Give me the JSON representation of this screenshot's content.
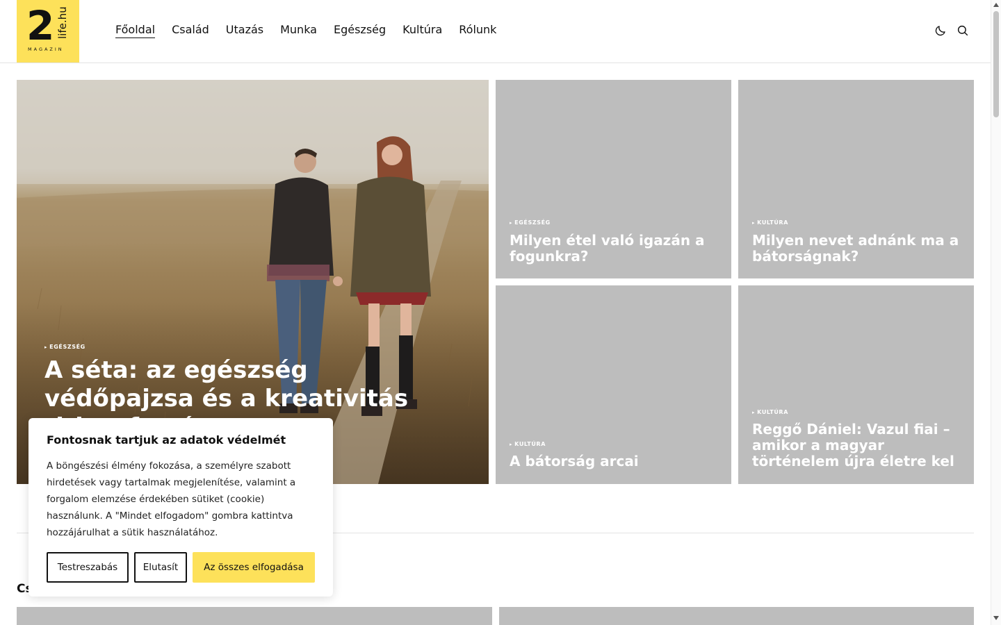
{
  "logo": {
    "number": "2",
    "site": "life.hu",
    "tagline": "MAGAZIN"
  },
  "nav": {
    "items": [
      {
        "label": "Főoldal",
        "active": true
      },
      {
        "label": "Család"
      },
      {
        "label": "Utazás"
      },
      {
        "label": "Munka"
      },
      {
        "label": "Egészség"
      },
      {
        "label": "Kultúra"
      },
      {
        "label": "Rólunk"
      }
    ]
  },
  "header_icons": {
    "theme": "moon-icon",
    "search": "search-icon"
  },
  "hero": {
    "category": "EGÉSZSÉG",
    "title": "A séta: az egészség védőpajzsa és a kreativitás titkos forrása"
  },
  "cards": [
    {
      "category": "EGÉSZSÉG",
      "title": "Milyen étel való igazán a fogunkra?"
    },
    {
      "category": "KULTÚRA",
      "title": "Milyen nevet adnánk ma a bátorságnak?"
    },
    {
      "category": "KULTÚRA",
      "title": "A bátorság arcai"
    },
    {
      "category": "KULTÚRA",
      "title": "Reggő Dániel: Vazul fiai – amikor a magyar történelem újra életre kel"
    }
  ],
  "section": {
    "heading": "Cs"
  },
  "cookie": {
    "title": "Fontosnak tartjuk az adatok védelmét",
    "text": "A böngészési élmény fokozása, a személyre szabott hirdetések vagy tartalmak megjelenítése, valamint a forgalom elemzése érdekében sütiket (cookie) használunk. A \"Mindet elfogadom\" gombra kattintva hozzájárulhat a sütik használatához.",
    "buttons": {
      "customize": "Testreszabás",
      "reject": "Elutasít",
      "accept": "Az összes elfogadása"
    }
  },
  "colors": {
    "accent": "#fde15a",
    "card_placeholder": "#bdbdbd"
  }
}
